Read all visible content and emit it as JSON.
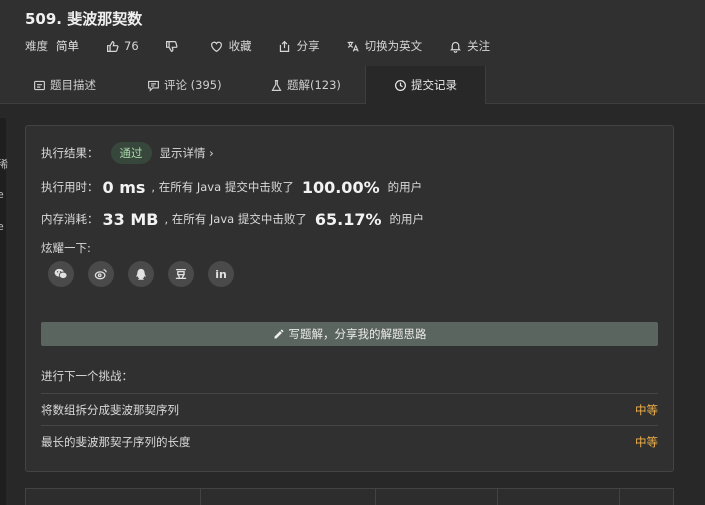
{
  "problem": {
    "title": "509. 斐波那契数",
    "difficulty_label": "难度",
    "difficulty_value": "简单",
    "likes": "76",
    "favorite_label": "收藏",
    "share_label": "分享",
    "switch_lang_label": "切换为英文",
    "follow_label": "关注"
  },
  "tabs": [
    {
      "label": "题目描述",
      "icon": "description-icon"
    },
    {
      "label": "评论 (395)",
      "icon": "comment-icon"
    },
    {
      "label": "题解(123)",
      "icon": "flask-icon"
    },
    {
      "label": "提交记录",
      "icon": "clock-icon"
    }
  ],
  "result": {
    "status_label": "执行结果：",
    "status_badge": "通过",
    "details_link": "显示详情 ›",
    "runtime_label": "执行用时：",
    "runtime_value": "0 ms",
    "runtime_mid": ", 在所有 Java 提交中击败了",
    "runtime_percent": "100.00%",
    "runtime_suffix": "的用户",
    "memory_label": "内存消耗：",
    "memory_value": "33 MB",
    "memory_mid": ", 在所有 Java 提交中击败了",
    "memory_percent": "65.17%",
    "memory_suffix": "的用户",
    "share_prompt": "炫耀一下:",
    "share_icons": [
      "wechat-icon",
      "weibo-icon",
      "qq-icon",
      "douban-icon",
      "linkedin-icon"
    ],
    "douban_glyph": "豆",
    "linkedin_glyph": "in",
    "write_button": "写题解，分享我的解题思路",
    "next_label": "进行下一个挑战：",
    "challenges": [
      {
        "title": "将数组拆分成斐波那契序列",
        "level": "中等"
      },
      {
        "title": "最长的斐波那契子序列的长度",
        "level": "中等"
      }
    ]
  },
  "left_strip_glyphs": [
    "稀",
    "e",
    "e"
  ],
  "colors": {
    "background": "#282828",
    "panel": "#303030",
    "accepted": "#a8d8a8",
    "medium": "#f0b14a",
    "button": "#5b6560"
  }
}
